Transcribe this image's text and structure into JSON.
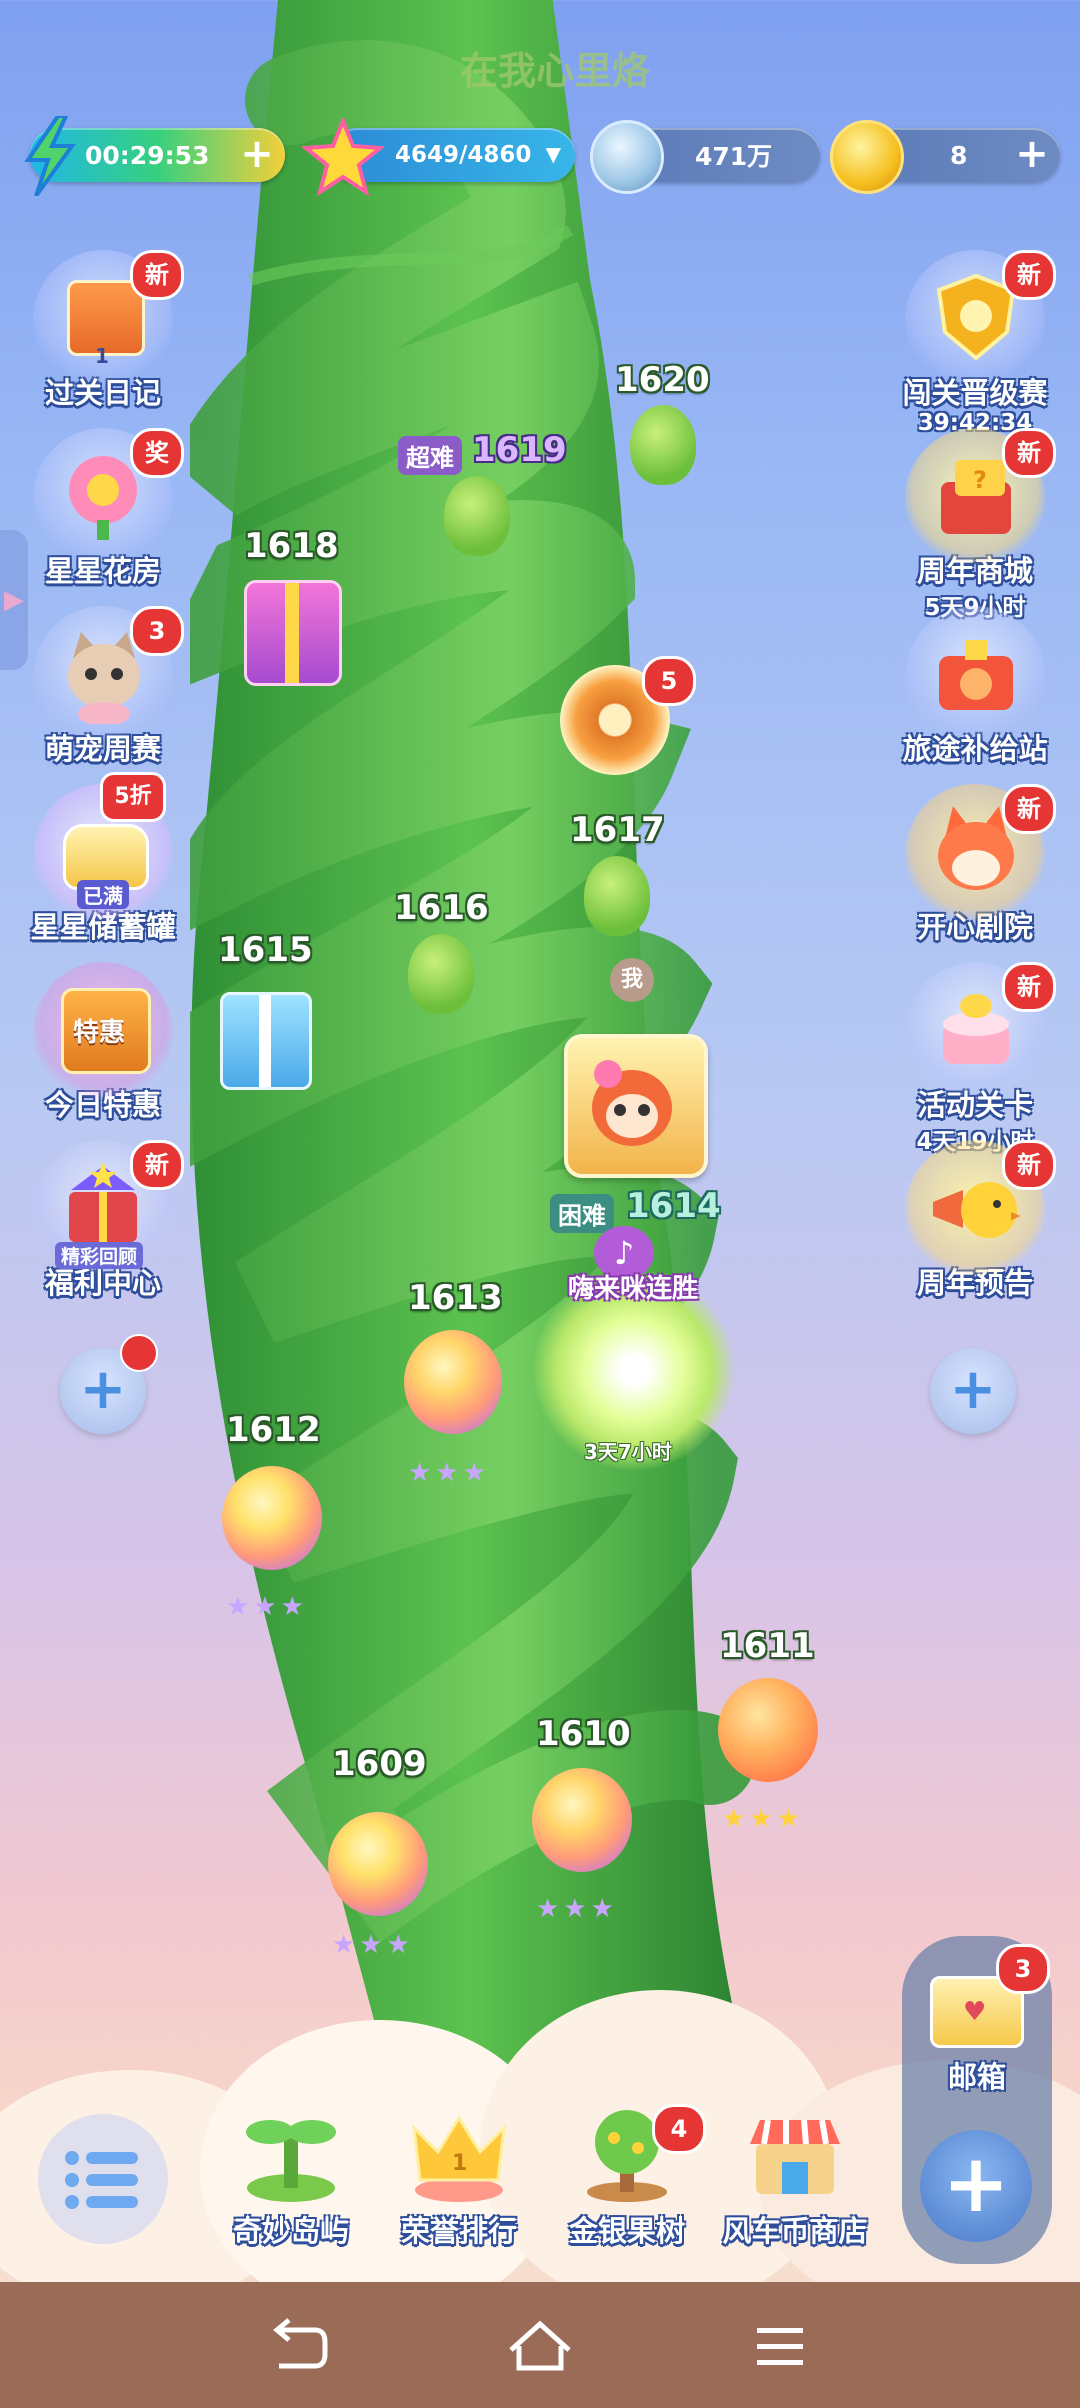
{
  "header": {
    "song_title": "在我心里烙",
    "energy_timer": "00:29:53",
    "stars_progress": "4649/4860",
    "coins_amount": "471万",
    "gold_count": "8"
  },
  "left_features": [
    {
      "label": "过关日记",
      "badge": "新",
      "sub": ""
    },
    {
      "label": "星星花房",
      "badge": "奖",
      "sub": ""
    },
    {
      "label": "萌宠周赛",
      "badge": "3",
      "sub": ""
    },
    {
      "label": "星星储蓄罐",
      "badge": "5折",
      "sub": ""
    },
    {
      "label": "今日特惠",
      "badge": "",
      "sub": ""
    },
    {
      "label": "福利中心",
      "badge": "新",
      "sub": ""
    }
  ],
  "left_extras": {
    "diary_num": "1",
    "piggy_full": "已满",
    "deal_sign": "特惠",
    "welfare_tag": "精彩回顾"
  },
  "right_features": [
    {
      "label": "闯关晋级赛",
      "badge": "新",
      "sub": "39:42:34"
    },
    {
      "label": "周年商城",
      "badge": "新",
      "sub": "5天9小时"
    },
    {
      "label": "旅途补给站",
      "badge": "",
      "sub": ""
    },
    {
      "label": "开心剧院",
      "badge": "新",
      "sub": ""
    },
    {
      "label": "活动关卡",
      "badge": "新",
      "sub": "4天19小时"
    },
    {
      "label": "周年预告",
      "badge": "新",
      "sub": ""
    }
  ],
  "levels": {
    "l1609": "1609",
    "l1610": "1610",
    "l1611": "1611",
    "l1612": "1612",
    "l1613": "1613",
    "l1614": "1614",
    "l1615": "1615",
    "l1616": "1616",
    "l1617": "1617",
    "l1618": "1618",
    "l1619": "1619",
    "l1620": "1620"
  },
  "level_tags": {
    "super_hard": "超难",
    "hard": "困难",
    "me": "我"
  },
  "spin_badge": "5",
  "event_bubble": {
    "title": "嗨来咪连胜",
    "timer": "3天7小时"
  },
  "bottom_nav": [
    {
      "label": "奇妙岛屿"
    },
    {
      "label": "荣誉排行"
    },
    {
      "label": "金银果树",
      "badge": "4"
    },
    {
      "label": "风车币商店"
    }
  ],
  "mailbox": {
    "label": "邮箱",
    "badge": "3"
  },
  "colors": {
    "badge_red": "#e53535",
    "stem_green": "#3ea744",
    "nav_brown": "#9a6b57"
  }
}
